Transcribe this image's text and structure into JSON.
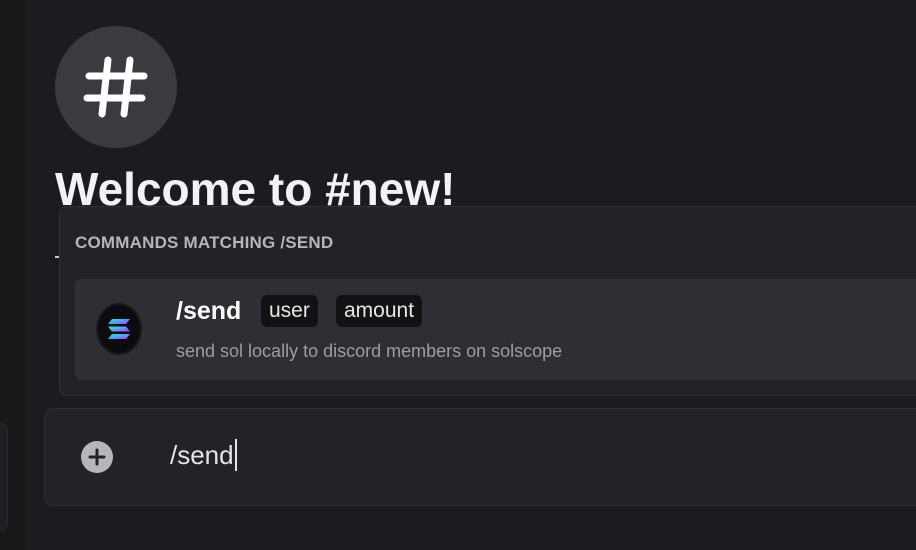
{
  "channel": {
    "icon": "hashtag-icon",
    "welcome_title": "Welcome to #new!"
  },
  "autocomplete": {
    "header": "COMMANDS MATCHING /SEND",
    "items": [
      {
        "avatar_icon": "solana-logo-icon",
        "command": "/send",
        "params": [
          "user",
          "amount"
        ],
        "description": "send sol locally to discord members on solscope"
      }
    ]
  },
  "message_input": {
    "value": "/send",
    "attach_icon": "plus-circle-icon"
  },
  "colors": {
    "background": "#1c1c20",
    "popup": "#222227",
    "selected_item": "#2e2f34",
    "param_chip": "#111214",
    "text_primary": "#ffffff",
    "text_muted": "#9c9da3"
  }
}
